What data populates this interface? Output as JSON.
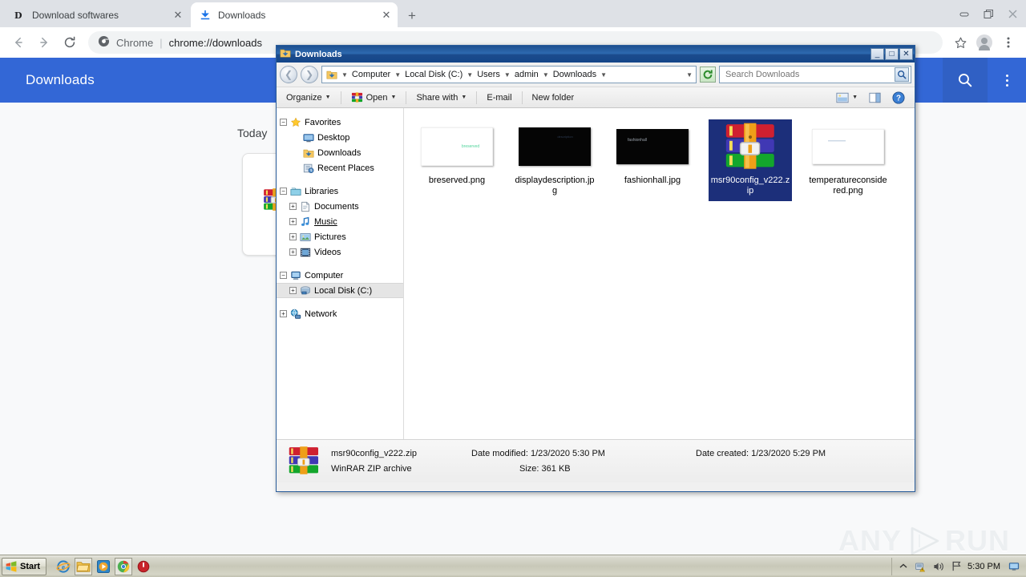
{
  "browser": {
    "tabs": [
      {
        "title": "Download softwares",
        "icon": "dictionary-favicon",
        "active": false
      },
      {
        "title": "Downloads",
        "icon": "download-favicon",
        "active": true
      }
    ],
    "new_tab_label": "+",
    "window_controls": {
      "minimize": "minimize-icon",
      "restore": "restore-icon",
      "close": "close-icon"
    },
    "nav": {
      "back": "back-icon",
      "forward": "forward-icon",
      "reload": "reload-icon"
    },
    "omnibox": {
      "site_chip": "Chrome",
      "separator": "|",
      "url": "chrome://downloads"
    },
    "toolbar_right": {
      "bookmark": "star-icon",
      "profile": "avatar-icon",
      "menu": "three-dot-menu-icon"
    }
  },
  "downloads_page": {
    "header_title": "Downloads",
    "search_icon": "search-icon",
    "menu_icon": "three-dot-menu-icon",
    "day_label": "Today",
    "card_icon": "winrar-archive-icon",
    "accent_color": "#3367d6"
  },
  "watermark": {
    "left": "ANY",
    "right": "RUN",
    "logo": "play-triangle-icon"
  },
  "explorer": {
    "title": "Downloads",
    "title_icon": "downloads-folder-icon",
    "window_buttons": {
      "minimize": "_",
      "maximize": "□",
      "close": "✕"
    },
    "nav_back": "back-arrow-icon",
    "nav_forward": "forward-arrow-icon",
    "address_icon": "downloads-folder-icon",
    "breadcrumbs": [
      "Computer",
      "Local Disk (C:)",
      "Users",
      "admin",
      "Downloads"
    ],
    "address_dropdown": "chevron-down-icon",
    "refresh_icon": "refresh-icon",
    "search": {
      "placeholder": "Search Downloads",
      "value": "",
      "go_icon": "search-icon"
    },
    "toolbar": [
      {
        "label": "Organize",
        "caret": true,
        "icon": null
      },
      {
        "label": "Open",
        "caret": true,
        "icon": "winrar-archive-icon"
      },
      {
        "label": "Share with",
        "caret": true,
        "icon": null
      },
      {
        "label": "E-mail",
        "caret": false,
        "icon": null
      },
      {
        "label": "New folder",
        "caret": false,
        "icon": null
      }
    ],
    "toolbar_right": [
      {
        "name": "change-view-icon",
        "caret": true
      },
      {
        "name": "preview-pane-icon",
        "caret": false
      },
      {
        "name": "help-icon",
        "caret": false
      }
    ],
    "nav_tree": [
      {
        "label": "Favorites",
        "icon": "star-icon",
        "expander": "minus",
        "indent": 0,
        "selected": false,
        "underline": false
      },
      {
        "label": "Desktop",
        "icon": "desktop-icon",
        "expander": "none",
        "indent": 1,
        "selected": false,
        "underline": false
      },
      {
        "label": "Downloads",
        "icon": "downloads-folder-icon",
        "expander": "none",
        "indent": 1,
        "selected": false,
        "underline": false
      },
      {
        "label": "Recent Places",
        "icon": "recent-places-icon",
        "expander": "none",
        "indent": 1,
        "selected": false,
        "underline": false
      },
      {
        "gap": true
      },
      {
        "label": "Libraries",
        "icon": "libraries-icon",
        "expander": "minus",
        "indent": 0,
        "selected": false,
        "underline": false
      },
      {
        "label": "Documents",
        "icon": "documents-icon",
        "expander": "plus",
        "indent": 1,
        "selected": false,
        "underline": false
      },
      {
        "label": "Music",
        "icon": "music-note-icon",
        "expander": "plus",
        "indent": 1,
        "selected": false,
        "underline": true
      },
      {
        "label": "Pictures",
        "icon": "pictures-icon",
        "expander": "plus",
        "indent": 1,
        "selected": false,
        "underline": false
      },
      {
        "label": "Videos",
        "icon": "videos-icon",
        "expander": "plus",
        "indent": 1,
        "selected": false,
        "underline": false
      },
      {
        "gap": true
      },
      {
        "label": "Computer",
        "icon": "computer-icon",
        "expander": "minus",
        "indent": 0,
        "selected": false,
        "underline": false
      },
      {
        "label": "Local Disk (C:)",
        "icon": "hard-disk-icon",
        "expander": "plus",
        "indent": 1,
        "selected": true,
        "underline": false
      },
      {
        "gap": true
      },
      {
        "label": "Network",
        "icon": "network-icon",
        "expander": "plus",
        "indent": 0,
        "selected": false,
        "underline": false
      }
    ],
    "files": [
      {
        "name": "breserved.png",
        "thumb": "white-image-green-text",
        "selected": false
      },
      {
        "name": "displaydescription.jpg",
        "thumb": "black-image",
        "selected": false
      },
      {
        "name": "fashionhall.jpg",
        "thumb": "black-image-white-text",
        "selected": false
      },
      {
        "name": "msr90config_v222.zip",
        "thumb": "winrar-archive-icon",
        "selected": true
      },
      {
        "name": "temperatureconsidered.png",
        "thumb": "white-image-faint-text",
        "selected": false
      }
    ],
    "status": {
      "icon": "winrar-archive-icon",
      "file_name": "msr90config_v222.zip",
      "file_type": "WinRAR ZIP archive",
      "date_modified_label": "Date modified:",
      "date_modified_value": "1/23/2020 5:30 PM",
      "size_label": "Size:",
      "size_value": "361 KB",
      "date_created_label": "Date created:",
      "date_created_value": "1/23/2020 5:29 PM"
    }
  },
  "taskbar": {
    "start_label": "Start",
    "start_icon": "windows-logo-icon",
    "quick_launch": [
      {
        "name": "internet-explorer-icon",
        "active": false
      },
      {
        "name": "windows-explorer-icon",
        "active": true
      },
      {
        "name": "media-player-icon",
        "active": false
      },
      {
        "name": "chrome-icon",
        "active": true
      },
      {
        "name": "shutdown-red-icon",
        "active": false
      }
    ],
    "tray": {
      "chevron": "show-hidden-icons-icon",
      "network": "network-warning-icon",
      "volume": "volume-icon",
      "action_center": "action-center-flag-icon",
      "clock": "5:30 PM",
      "show_desktop": "show-desktop-icon"
    }
  }
}
